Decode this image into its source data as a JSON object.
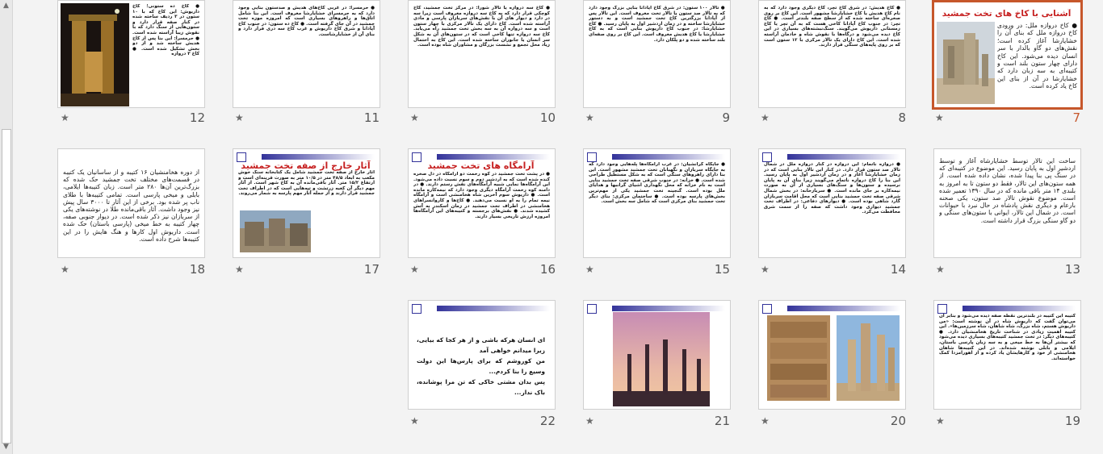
{
  "slides": [
    {
      "id": 12,
      "num": "12",
      "body": "● کاخ ده ستونی؛ کاخ داریوش: این کاخ که با ۱۰ ستون در ۳ ردیف ساخته شده در کنار صفه قرار دارد و ستون‌هایی از سنگ دارد که با نقوش زیبا آراسته شده است. ● حرمسرا: این بنا پس از کاخ هدیش ساخته شد و از دو بخش تشکیل شده است. ● کاخ ۳ دروازه"
    },
    {
      "id": 11,
      "num": "11",
      "body": "● حرمسرا: در غربی کاخ‌های هدیش و صدستون بنایی وجود دارد که به حرمسرای خشایارشا معروف است. این بنا شامل اتاق‌ها و راهروهای بسیاری است که امروزه موزه تخت جمشید در آن جای گرفته است. ● کاخ ده ستون: در جنوب کاخ آپادانا و شرق کاخ داریوش و غرب کاخ سه دری قرار دارد و بنای آن از خشایارشاست."
    },
    {
      "id": 10,
      "num": "10",
      "body": "● کاخ سه دروازه یا تالار شورا: در مرکز تخت جمشید، کاخ کوچکی قرار دارد که به کاخ سه دروازه معروف است زیرا سه در دارد و دیوار های آن با نقش‌های سربازان پارسی و مادی آراسته شده است. کاخ دارای یک تالار مرکزی با چهار ستون است و سه دروازه آن به سه بخش تخت جمشید راه می‌یابد. کاخ سه دروازه تنها کاخی است که در ستون‌های آن به شکل سر انسان یا جانوران ساخته شده است. این کاخ به احتمال زیاد محل تجمع و نشست بزرگان و مشاوران شاه بوده است."
    },
    {
      "id": 9,
      "num": "9",
      "body": "● تالار ۱۰۰ ستون: در شرق کاخ آپادانا بنایی بزرگ وجود دارد که به تالار صد ستون یا تالار تخت معروف است. این تالار پس از آپادانا بزرگترین کاخ تخت جمشید است و به دستور خشایارشا ساخته و در زمان اردشیر اول به پایان رسید. ● کاخ خشایارشا: در جنوب کاخ داریوش بنایی است که به کاخ خشایارشا یا کاخ هدیش معروف است. این کاخ بر روی صفه‌ای بلند ساخته شده و دو پلکان دارد."
    },
    {
      "id": 8,
      "num": "8",
      "body": "● کاخ هدیش: در شرق کاخ تچر، کاخ دیگری وجود دارد که به نام کاخ هدیش یا کاخ خشایارشا مشهور است. این کاخ بر روی صخره‌ای ساخته شده که از سطح صفه بلندتر است. ● کاخ تچر: در جنوب کاخ آپادانا کاخی هست که به آن تچر یا کاخ زمستانی داریوش می‌گویند. سنگ‌نبشته‌های بسیاری در این کاخ دیده می‌شود و درگاه‌ها با نقوش شاه و خادمان آراسته شده است. این کاخ دارای یک تالار مرکزی با ۱۲ ستون است که بر روی پایه‌های سنگی قرار دارند."
    },
    {
      "id": 7,
      "num": "7",
      "title": "آشنایی با کاخ های تخت جمشید",
      "body": "● کاخ دروازه ملل: در ورودی کاخ دروازه ملل که بنای آن را خشایارشا آغاز کرده است؛ نقش‌های دو گاو بالدار با سر انسان دیده می‌شود. این کاخ دارای چهار ستون بلند است و کتیبه‌ای به سه زبان دارد که خشایارشا در آن از بنای این کاخ یاد کرده است."
    },
    {
      "id": 18,
      "num": "18",
      "body": "از دوره هخامنشیان ۱۶ کتیبه و از ساسانیان یک کتیبه در قسمت‌های مختلف تخت جمشید حک شده که بزرگ‌ترین آن‌ها ۲۸۰ متر است. زبان کتیبه‌ها ایلامی، بابلی و میخی پارسی است. تمامی کتیبه‌ها با طلای ناب پر شده بود. برخی از این آثار تا ۳۰۰۰ سال پیش نیز وجود داشت. آثار باقی‌مانده طلا در نوشته‌های یکی از سربازان نیز ذکر شده است. در دیوار جنوبی صفه، چهار کتیبه به خط میخی (پارسی باستان) حک شده است. داریوش اول کارها و هنگ هایش را در این کتیبه‌ها شرح داده است."
    },
    {
      "id": 17,
      "num": "17",
      "title": "آثار خارج از صفه تخت جمشید",
      "body": "آثار خارج از صفه تخت جمشید شامل یک کتابخانه سنگ خوش مکعب به ابعاد ۴۸/۵ متر در ۱۰/۵ متر به صورت قرینه‌ای است و ارتفاع ۱۵/۲ متر. آثار باقی‌مانده آن به کاخ شهر است. از آثار مهم دیگر آن کعبه زرتشت و تپه‌هایی است که در اطراف تخت جمشید قرار دارند و از جمله آثار مهم پارسه به شمار می‌روند."
    },
    {
      "id": 16,
      "num": "16",
      "title": "آرامگاه های تخت جمشید",
      "body": "● در پشت تخت جمشید در کوه رحمت دو آرامگاه در دل صخره کنده شده است که به اردشیر دوم و سوم نسبت داده می‌شود. این آرامگاه‌ها نمایی شبیه آرامگاه‌های نقش رستم دارند. ● در دامنه کوه رحمت آرامگاه دیگری وجود دارد که نیمه‌کاره مانده است. ● داریوش سوم آخرین شاه هخامنشی است و آرامگاه نیمه تمام را به او نسبت می‌دهند. ● کاخ‌ها و کاروانسراهای هخامنشی در اطراف تخت جمشید در زمان اسکندر به آتش کشیده شدند. ● نقش‌های برجسته و کتیبه‌های این آرامگاه‌ها امروزه ارزش تاریخی بسیار دارند."
    },
    {
      "id": 15,
      "num": "15",
      "body": "● جایگاه کرانشیان: در غرب آرامگاه‌ها پله‌هایی وجود دارد که به جایگاه سربازان و نگهبانان تخت جمشید مشهور است. این بنا دارای راهروهای سنگی است که به شکل مستطیل طراحی شده است. ● خزانه: در جنوب شرقی صفه تخت جمشید بنایی است به نام خزانه که محل نگهداری اشیای گرانبها و هدایای ملل بوده است. گنجینه تخت جمشید یکی از مهم‌ترین بخش‌های پارسه بوده است. ● ساختمان مرکزی: بنای دیگر تخت جمشید بنای مرکزی است که شامل سه بخش است."
    },
    {
      "id": 14,
      "num": "14",
      "body": "● دروازه ناتمام: این دروازه در کنار دروازه ملل در شمال تالار صد ستون قرار دارد. در کنار این تالار بنایی است که در زمان خشایارشا آغاز و در زمان اردشیر اول به پایان رسید. این بنا را کاخ دروازه ناتمام می‌گویند زیرا بنای آن به پایان نرسیده و ستون‌ها و سنگ‌های بسیاری از آن به صورت نیمه‌کاره بر جای مانده است. ● سربازخانه: در بخش شمال شرقی صفه تخت جمشید بنایی است که محل اقامت سربازان گارد شاهی بوده است. ● دیوارهای دفاعی: در اطراف تخت جمشید دیواری وجود داشت که صفه را از سمت شرق محافظت می‌کرد."
    },
    {
      "id": 13,
      "num": "13",
      "body": "ساخت این تالار توسط خشایارشاه آغاز و توسط اردشیر اول به پایان رسید. این موضوع در کتیبه‌ای که در سنگ پی بنا پیدا شده، نشان داده شده است. از همه ستون‌های این تالار، فقط دو ستون تا به امروز به بلندی ۱۴ متر باقی مانده که در سال ۱۳۹۰ تعمیر شده است. موضوع نقوش تالار صد ستون، یکی صحنه بارعام و دیگری نقش پادشاه در حال نبرد با حیوانات است. در شمال این تالار، ایوانی با ستون‌های سنگی و دو گاو سنگی بزرگ قرار داشته است."
    },
    {
      "id": 22,
      "num": "22",
      "lines": [
        "ای انسان هرکه باشی و از هر کجا که بیایی، زیرا میدانم خواهی آمد",
        "من کوروشم که برای پارس‌ها این دولت وسیع را بنا کردم...",
        "پس بدان مشتی خاکی که تن مرا پوشانده، باک ندار..."
      ]
    },
    {
      "id": 21,
      "num": "21"
    },
    {
      "id": 20,
      "num": "20"
    },
    {
      "id": 19,
      "num": "19",
      "body": "کتیبه این کتیبه در بلندترین نقطه صفه دیده می‌شود و بنابر آن می‌توان گفت که داریوش شاه در آن نوشته است: «من داریوش هستم، شاه بزرگ، شاه شاهان، شاه سرزمین‌ها». این کتیبه اهمیت زیادی در شناخت تاریخ هخامنشیان دارد. ● کتیبه‌های دیگر: در تخت جمشید کتیبه‌های بسیاری دیده می‌شود که بیشتر آن‌ها به خط میخی و به سه زبان پارسی باستان، ایلامی و بابلی نوشته شده‌اند. در این کتیبه‌ها شاهان هخامنشی از خود و کارهایشان یاد کرده و از اهورامزدا کمک خواسته‌اند."
    }
  ],
  "star": "★"
}
